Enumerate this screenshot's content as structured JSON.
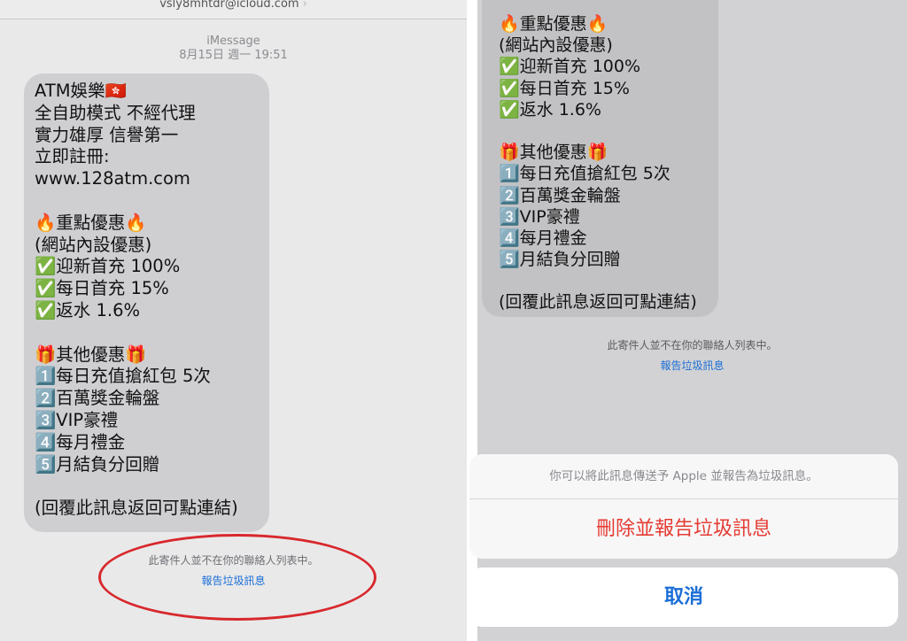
{
  "left": {
    "sender_email": "vsly8mhtdr@icloud.com",
    "chevron": "›",
    "service": "iMessage",
    "timestamp": "8月15日 週一 19:51",
    "message_lines": [
      "ATM娛樂🇭🇰",
      "全自助模式 不經代理",
      "實力雄厚 信譽第一",
      "立即註冊:",
      "www.128atm.com",
      "",
      "🔥重點優惠🔥",
      " (網站內設優惠)",
      "✅迎新首充 100%",
      "✅每日首充 15%",
      "✅返水 1.6%",
      "",
      "🎁其他優惠🎁",
      "1️⃣每日充值搶紅包 5次",
      "2️⃣百萬獎金輪盤",
      "3️⃣VIP豪禮",
      "4️⃣每月禮金",
      "5️⃣月結負分回贈",
      "",
      "(回覆此訊息返回可點連結)"
    ],
    "not_in_contacts": "此寄件人並不在你的聯絡人列表中。",
    "report_junk": "報告垃圾訊息"
  },
  "right": {
    "message_lines": [
      "🔥重點優惠🔥",
      " (網站內設優惠)",
      "✅迎新首充 100%",
      "✅每日首充 15%",
      "✅返水 1.6%",
      "",
      "🎁其他優惠🎁",
      "1️⃣每日充值搶紅包 5次",
      "2️⃣百萬獎金輪盤",
      "3️⃣VIP豪禮",
      "4️⃣每月禮金",
      "5️⃣月結負分回贈",
      "",
      "(回覆此訊息返回可點連結)"
    ],
    "not_in_contacts": "此寄件人並不在你的聯絡人列表中。",
    "report_junk": "報告垃圾訊息",
    "sheet": {
      "message": "你可以將此訊息傳送予 Apple 並報告為垃圾訊息。",
      "delete_report": "刪除並報告垃圾訊息",
      "cancel": "取消"
    }
  },
  "colors": {
    "annotation_circle": "#d8282c",
    "link_blue": "#1b6fd6",
    "destructive_red": "#e53b32"
  }
}
